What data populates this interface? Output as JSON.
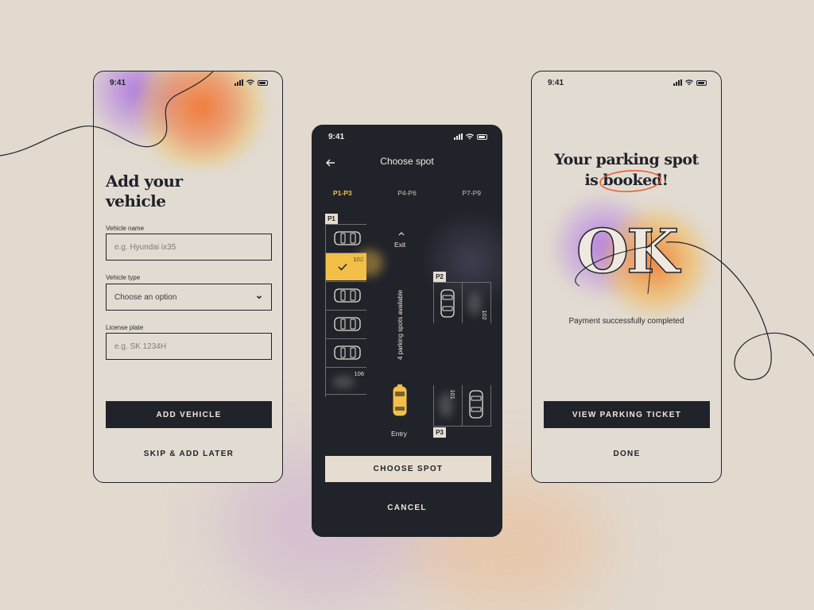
{
  "status_time": "9:41",
  "add_vehicle": {
    "title": "Add your vehicle",
    "fields": [
      {
        "label": "Vehicle name",
        "placeholder": "e.g. Hyundai ix35"
      },
      {
        "label": "Vehicle type",
        "placeholder": "Choose an option"
      },
      {
        "label": "License plate",
        "placeholder": "e.g. SK 1234H"
      }
    ],
    "primary_button": "ADD VEHICLE",
    "secondary_button": "SKIP & ADD LATER"
  },
  "choose_spot": {
    "title": "Choose spot",
    "tabs": [
      {
        "label": "P1-P3",
        "active": true
      },
      {
        "label": "P4-P6",
        "active": false
      },
      {
        "label": "P7-P9",
        "active": false
      }
    ],
    "zones": {
      "p1": "P1",
      "p2": "P2",
      "p3": "P3"
    },
    "spots": {
      "selected": "102",
      "p1_last": "106",
      "p2_spot": "102",
      "p3_spot": "101"
    },
    "availability": "4 parking spots available",
    "exit_label": "Exit",
    "entry_label": "Entry",
    "primary_button": "CHOOSE SPOT",
    "secondary_button": "CANCEL",
    "accent": "#f2bf48"
  },
  "booked": {
    "title_line1": "Your parking spot",
    "title_line2_prefix": "is ",
    "title_highlight": "booked",
    "title_suffix": "!",
    "big_text": "OK",
    "subtitle": "Payment successfully completed",
    "primary_button": "VIEW PARKING TICKET",
    "secondary_button": "DONE",
    "highlight_color": "#e4582a"
  }
}
